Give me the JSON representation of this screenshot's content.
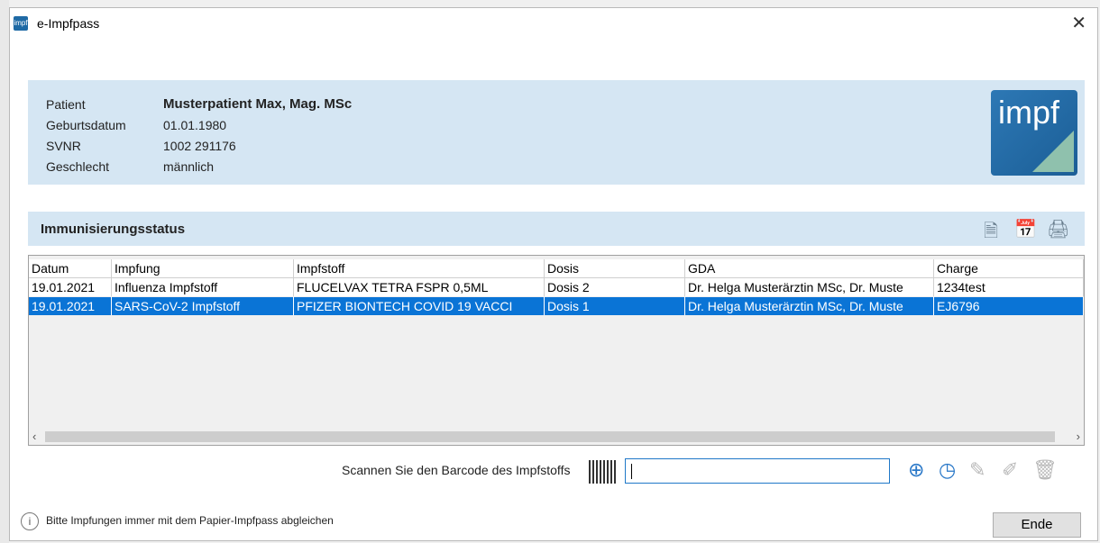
{
  "window": {
    "title": "e-Impfpass",
    "close_glyph": "✕",
    "icon_text": "impf"
  },
  "patient": {
    "labels": {
      "patient": "Patient",
      "birthdate": "Geburtsdatum",
      "svnr": "SVNR",
      "gender": "Geschlecht"
    },
    "values": {
      "patient": "Musterpatient Max, Mag. MSc",
      "birthdate": "01.01.1980",
      "svnr": "1002 291176",
      "gender": "männlich"
    },
    "logo_text": "impf"
  },
  "immunization": {
    "title": "Immunisierungsstatus",
    "toolbar_icons": [
      "document-search-icon",
      "calendar-add-icon",
      "printer-icon"
    ],
    "columns": [
      "Datum",
      "Impfung",
      "Impfstoff",
      "Dosis",
      "GDA",
      "Charge"
    ],
    "rows": [
      [
        "19.01.2021",
        "Influenza Impfstoff",
        "FLUCELVAX TETRA FSPR 0,5ML",
        "Dosis 2",
        "Dr. Helga Musterärztin MSc, Dr. Muste",
        "1234test"
      ],
      [
        "19.01.2021",
        "SARS-CoV-2 Impfstoff",
        "PFIZER BIONTECH COVID 19 VACCI",
        "Dosis 1",
        "Dr. Helga Musterärztin MSc, Dr. Muste",
        "EJ6796"
      ]
    ],
    "selected_row": 1
  },
  "scan": {
    "label": "Scannen Sie den Barcode des Impfstoffs",
    "value": ""
  },
  "actions": [
    {
      "name": "add-icon",
      "glyph": "⊕",
      "color": "#2a78c8"
    },
    {
      "name": "history-icon",
      "glyph": "◷",
      "color": "#2a78c8"
    },
    {
      "name": "edit-note-icon",
      "glyph": "✎",
      "color": "#b8b8b8"
    },
    {
      "name": "pencil-icon",
      "glyph": "✐",
      "color": "#b8b8b8"
    },
    {
      "name": "trash-icon",
      "glyph": "🗑",
      "color": "#b8b8b8"
    }
  ],
  "footer": {
    "info_text": "Bitte Impfungen immer mit dem Papier-Impfpass abgleichen",
    "info_glyph": "i",
    "end_button": "Ende"
  }
}
